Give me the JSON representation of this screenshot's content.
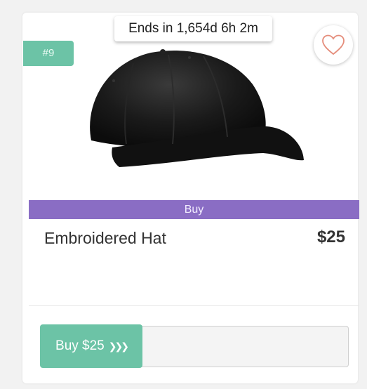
{
  "badge": {
    "rank": "#9"
  },
  "timer": {
    "text": "Ends in 1,654d 6h 2m"
  },
  "favorite": {
    "icon": "heart-icon",
    "color": "#e58d7b"
  },
  "product": {
    "image_icon": "baseball-cap",
    "buy_strip_label": "Buy",
    "name": "Embroidered Hat",
    "price": "$25"
  },
  "slider": {
    "label": "Buy $25",
    "chevron_icon": "triple-chevron-right-icon",
    "chevrons": "❯❯❯"
  },
  "colors": {
    "accent_green": "#6cc3a6",
    "accent_purple": "#8a6dc4",
    "heart": "#e58d7b"
  }
}
